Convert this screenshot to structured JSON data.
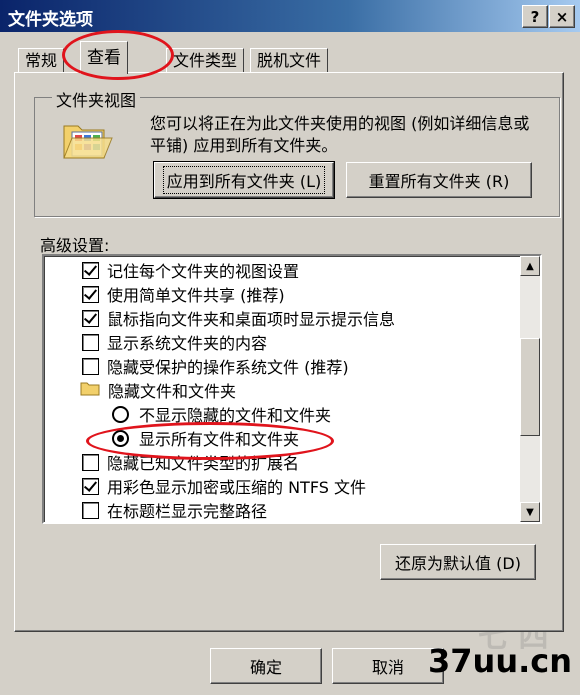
{
  "window": {
    "title": "文件夹选项",
    "help_button": "?",
    "close_button": "×"
  },
  "tabs": [
    {
      "label": "常规"
    },
    {
      "label": "查看",
      "active": true
    },
    {
      "label": "文件类型"
    },
    {
      "label": "脱机文件"
    }
  ],
  "folder_view": {
    "group_title": "文件夹视图",
    "description": "您可以将正在为此文件夹使用的视图 (例如详细信息或平铺) 应用到所有文件夹。",
    "apply_all_button": "应用到所有文件夹 (L)",
    "reset_all_button": "重置所有文件夹 (R)"
  },
  "advanced": {
    "label": "高级设置:",
    "items": [
      {
        "type": "checkbox",
        "checked": true,
        "label": "记住每个文件夹的视图设置"
      },
      {
        "type": "checkbox",
        "checked": true,
        "label": "使用简单文件共享 (推荐)"
      },
      {
        "type": "checkbox",
        "checked": true,
        "label": "鼠标指向文件夹和桌面项时显示提示信息"
      },
      {
        "type": "checkbox",
        "checked": false,
        "label": "显示系统文件夹的内容"
      },
      {
        "type": "checkbox",
        "checked": false,
        "label": "隐藏受保护的操作系统文件 (推荐)"
      },
      {
        "type": "folder",
        "label": "隐藏文件和文件夹"
      },
      {
        "type": "radio",
        "checked": false,
        "label": "不显示隐藏的文件和文件夹"
      },
      {
        "type": "radio",
        "checked": true,
        "label": "显示所有文件和文件夹"
      },
      {
        "type": "checkbox",
        "checked": false,
        "label": "隐藏已知文件类型的扩展名"
      },
      {
        "type": "checkbox",
        "checked": true,
        "label": "用彩色显示加密或压缩的 NTFS 文件"
      },
      {
        "type": "checkbox",
        "checked": false,
        "label": "在标题栏显示完整路径"
      }
    ],
    "restore_defaults_button": "还原为默认值 (D)"
  },
  "footer": {
    "ok_button": "确定",
    "cancel_button": "取消"
  },
  "watermark": "37uu.cn",
  "colors": {
    "title_bar": "#0a246a",
    "dialog_face": "#d4d0c8",
    "annotation_red": "#e0141c"
  }
}
